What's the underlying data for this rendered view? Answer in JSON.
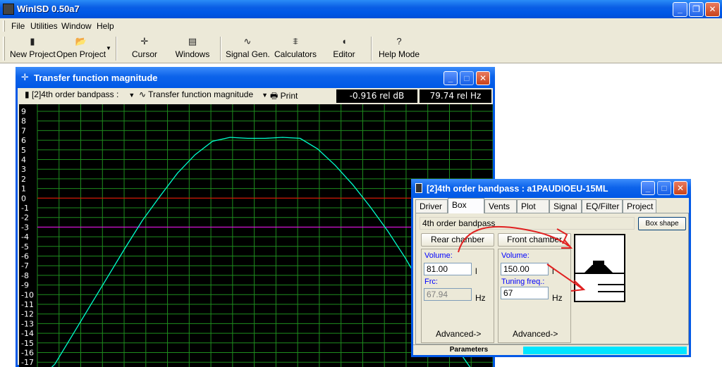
{
  "app": {
    "title": "WinISD 0.50a7"
  },
  "menu": [
    "File",
    "Utilities",
    "Window",
    "Help"
  ],
  "toolbar": {
    "new_project": "New Project",
    "open_project": "Open Project",
    "cursor": "Cursor",
    "windows": "Windows",
    "signal_gen": "Signal Gen.",
    "calculators": "Calculators",
    "editor": "Editor",
    "help_mode": "Help Mode"
  },
  "plot_window": {
    "title": "Transfer function magnitude",
    "project_select": "[2]4th order bandpass :",
    "plot_select": "Transfer function magnitude",
    "print": "Print",
    "readout_db": "-0.916 rel dB",
    "readout_hz": "79.74 rel Hz"
  },
  "chart_data": {
    "type": "line",
    "title": "",
    "xlabel": "",
    "ylabel": "",
    "y_ticks": [
      9,
      8,
      7,
      6,
      5,
      4,
      3,
      2,
      1,
      0,
      -1,
      -2,
      -3,
      -4,
      -5,
      -6,
      -7,
      -8,
      -9,
      -10,
      -11,
      -12,
      -13,
      -14,
      -15,
      -16,
      -17
    ],
    "ylim": [
      -17,
      9
    ],
    "grid": true,
    "reference_lines": [
      {
        "y": 0,
        "color": "#ff0000"
      },
      {
        "y": -3,
        "color": "#ff00ff"
      }
    ],
    "series": [
      {
        "color": "#00ffcc",
        "x": [
          0,
          10,
          20,
          30,
          40,
          50,
          60,
          70,
          80,
          90,
          100,
          110,
          120,
          130,
          140,
          150,
          160,
          170,
          180,
          190,
          200,
          210,
          220,
          230,
          240,
          250,
          260
        ],
        "y": [
          -19,
          -17.2,
          -14.2,
          -11.2,
          -8.2,
          -5.2,
          -2.3,
          0.2,
          2.6,
          4.5,
          5.9,
          6.3,
          6.2,
          6.2,
          6.3,
          6.2,
          5.1,
          3.4,
          1.4,
          -0.9,
          -3.4,
          -6.2,
          -9.3,
          -12.5,
          -15.7,
          -18.3,
          -19
        ]
      }
    ]
  },
  "dialog": {
    "title": "[2]4th order bandpass : a1PAUDIOEU-15ML",
    "tabs": [
      "Driver",
      "Box",
      "Vents",
      "Plot",
      "Signal",
      "EQ/Filter",
      "Project"
    ],
    "active_tab": "Box",
    "box_type": "4th order bandpass",
    "box_shape_btn": "Box shape",
    "rear_chamber": "Rear chamber",
    "front_chamber": "Front chamber",
    "rear": {
      "volume_label": "Volume:",
      "volume": "81.00",
      "volume_unit": "l",
      "frc_label": "Frc:",
      "frc": "67.94",
      "frc_unit": "Hz",
      "advanced": "Advanced->"
    },
    "front": {
      "volume_label": "Volume:",
      "volume": "150.00",
      "volume_unit": "l",
      "tuning_label": "Tuning freq.:",
      "tuning": "67",
      "tuning_unit": "Hz",
      "advanced": "Advanced->"
    },
    "status": "Parameters"
  }
}
